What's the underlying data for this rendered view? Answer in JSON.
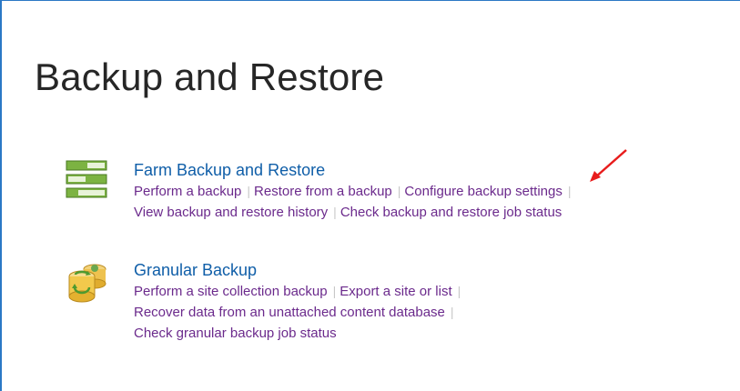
{
  "page": {
    "title": "Backup and Restore"
  },
  "sections": [
    {
      "icon": "farm-server-stack-icon",
      "heading": "Farm Backup and Restore",
      "links": [
        "Perform a backup",
        "Restore from a backup",
        "Configure backup settings",
        "View backup and restore history",
        "Check backup and restore job status"
      ]
    },
    {
      "icon": "granular-database-icon",
      "heading": "Granular Backup",
      "links": [
        "Perform a site collection backup",
        "Export a site or list",
        "Recover data from an unattached content database",
        "Check granular backup job status"
      ]
    }
  ],
  "annotation": {
    "arrow_color": "#e81c1c"
  },
  "colors": {
    "heading": "#0f5ea8",
    "link": "#6b2a8c",
    "separator": "#c8c8c8",
    "frame_border": "#2b78c5"
  }
}
